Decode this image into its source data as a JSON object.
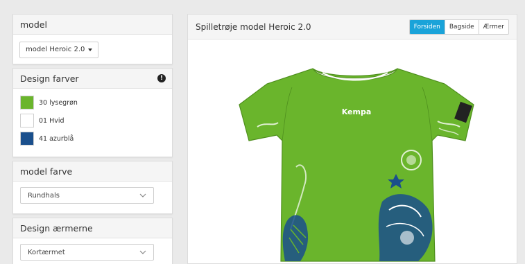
{
  "model_panel": {
    "title": "model",
    "dropdown_label": "model Heroic 2.0"
  },
  "design_colors": {
    "title": "Design farver",
    "info_icon": "exclamation-circle-icon",
    "swatches": [
      {
        "label": "30 lysegrøn",
        "color": "#6ab52c"
      },
      {
        "label": "01 Hvid",
        "color": "#ffffff"
      },
      {
        "label": "41 azurblå",
        "color": "#1a4f8c"
      }
    ]
  },
  "model_color": {
    "title": "model farve",
    "selected": "Rundhals"
  },
  "sleeve_design": {
    "title": "Design ærmerne",
    "selected": "Kortærmet"
  },
  "preview": {
    "title": "Spilletrøje model Heroic 2.0",
    "tabs": [
      {
        "label": "Forsiden",
        "active": true
      },
      {
        "label": "Bagside",
        "active": false
      },
      {
        "label": "Ærmer",
        "active": false
      }
    ],
    "shirt_brand": "Kempa",
    "accent_color": "#1aa3d9"
  }
}
